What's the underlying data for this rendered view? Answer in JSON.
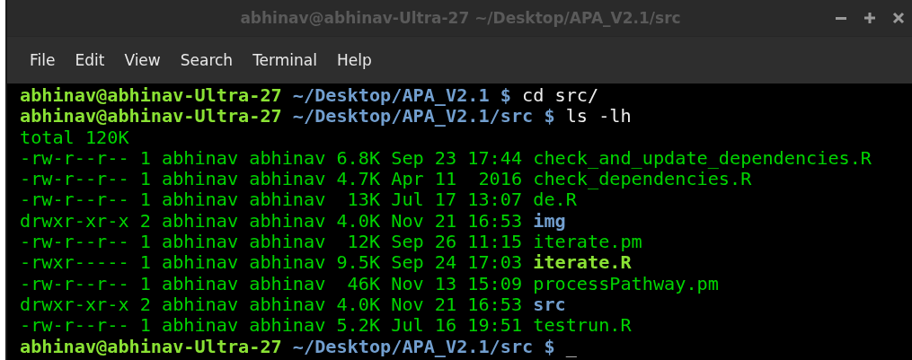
{
  "window": {
    "title": "abhinav@abhinav-Ultra-27 ~/Desktop/APA_V2.1/src"
  },
  "menu": [
    "File",
    "Edit",
    "View",
    "Search",
    "Terminal",
    "Help"
  ],
  "lines": [
    {
      "kind": "prompt",
      "user": "abhinav@abhinav-Ultra-27",
      "path": "~/Desktop/APA_V2.1",
      "symbol": "$",
      "command": "cd src/"
    },
    {
      "kind": "prompt",
      "user": "abhinav@abhinav-Ultra-27",
      "path": "~/Desktop/APA_V2.1/src",
      "symbol": "$",
      "command": "ls -lh"
    },
    {
      "kind": "output",
      "text": "total 120K"
    },
    {
      "kind": "entry",
      "details": "-rw-r--r-- 1 abhinav abhinav 6.8K Sep 23 17:44",
      "name": "check_and_update_dependencies.R",
      "directory": false,
      "executable": false
    },
    {
      "kind": "entry",
      "details": "-rw-r--r-- 1 abhinav abhinav 4.7K Apr 11  2016",
      "name": "check_dependencies.R",
      "directory": false,
      "executable": false
    },
    {
      "kind": "entry",
      "details": "-rw-r--r-- 1 abhinav abhinav  13K Jul 17 13:07",
      "name": "de.R",
      "directory": false,
      "executable": false
    },
    {
      "kind": "entry",
      "details": "drwxr-xr-x 2 abhinav abhinav 4.0K Nov 21 16:53",
      "name": "img",
      "directory": true,
      "executable": false
    },
    {
      "kind": "entry",
      "details": "-rw-r--r-- 1 abhinav abhinav  12K Sep 26 11:15",
      "name": "iterate.pm",
      "directory": false,
      "executable": false
    },
    {
      "kind": "entry",
      "details": "-rwxr----- 1 abhinav abhinav 9.5K Sep 24 17:03",
      "name": "iterate.R",
      "directory": false,
      "executable": true
    },
    {
      "kind": "entry",
      "details": "-rw-r--r-- 1 abhinav abhinav  46K Nov 13 15:09",
      "name": "processPathway.pm",
      "directory": false,
      "executable": false
    },
    {
      "kind": "entry",
      "details": "drwxr-xr-x 2 abhinav abhinav 4.0K Nov 21 16:53",
      "name": "src",
      "directory": true,
      "executable": false
    },
    {
      "kind": "entry",
      "details": "-rw-r--r-- 1 abhinav abhinav 5.2K Jul 16 19:51",
      "name": "testrun.R",
      "directory": false,
      "executable": false
    },
    {
      "kind": "prompt",
      "user": "abhinav@abhinav-Ultra-27",
      "path": "~/Desktop/APA_V2.1/src",
      "symbol": "$",
      "cursor": "_"
    }
  ]
}
